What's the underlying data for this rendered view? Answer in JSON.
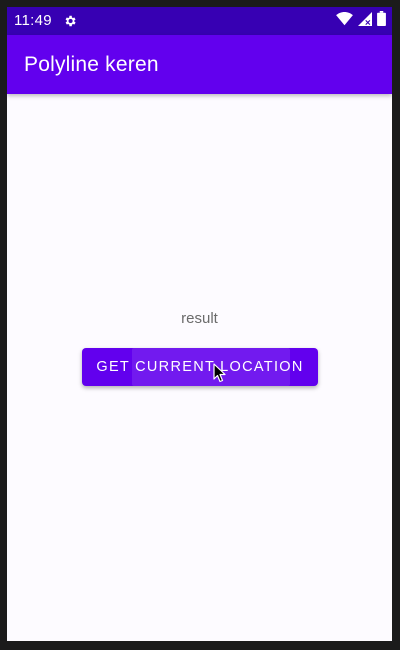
{
  "status_bar": {
    "time": "11:49",
    "icons": [
      "settings-gear-icon",
      "wifi-icon",
      "signal-icon",
      "battery-icon"
    ]
  },
  "app_bar": {
    "title": "Polyline keren"
  },
  "main": {
    "result_text": "result",
    "button_label": "GET CURRENT LOCATION"
  },
  "colors": {
    "status_bar": "#3700b3",
    "primary": "#6200ee",
    "background": "#fdfbff",
    "result_text": "#6b6b6b"
  }
}
